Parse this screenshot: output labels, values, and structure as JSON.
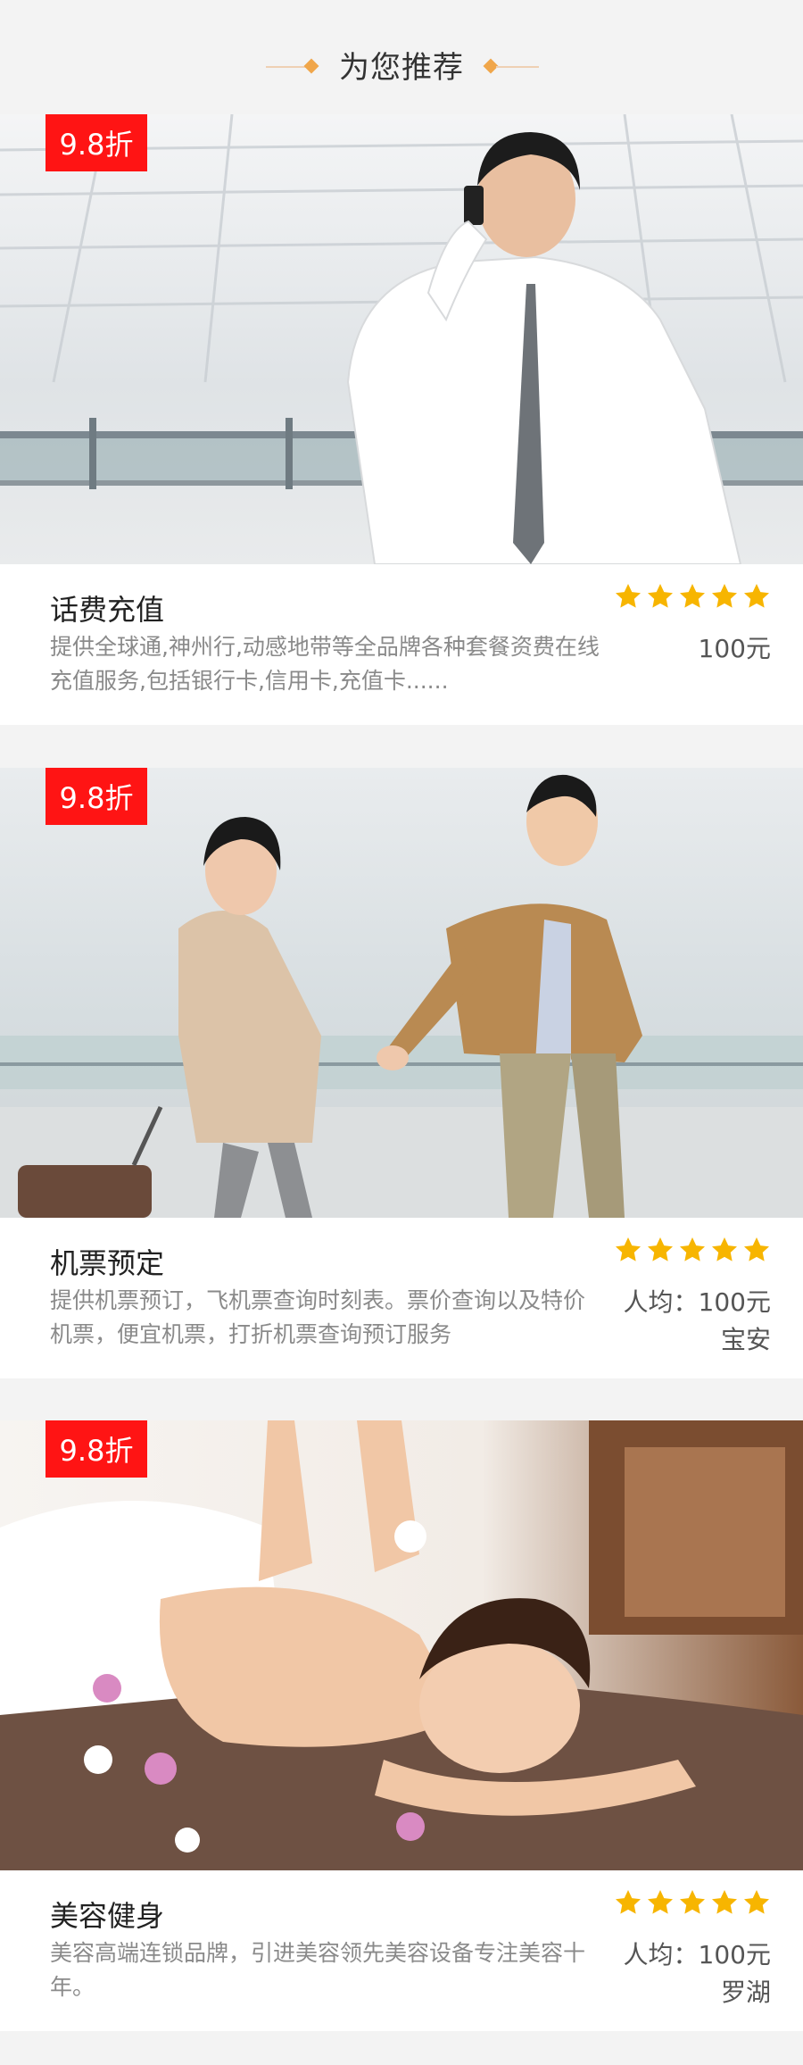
{
  "header": {
    "title": "为您推荐"
  },
  "accent_color": "#f0a64a",
  "badge_color": "#ff1414",
  "star_color": "#f7b500",
  "cards": [
    {
      "badge": "9.8折",
      "title": "话费充值",
      "description": "提供全球通,神州行,动感地带等全品牌各种套餐资费在线充值服务,包括银行卡,信用卡,充值卡......",
      "rating": 5,
      "price": "100元",
      "location": ""
    },
    {
      "badge": "9.8折",
      "title": "机票预定",
      "description": "提供机票预订，飞机票查询时刻表。票价查询以及特价机票，便宜机票，打折机票查询预订服务",
      "rating": 5,
      "price": "人均：100元",
      "location": "宝安"
    },
    {
      "badge": "9.8折",
      "title": "美容健身",
      "description": "美容高端连锁品牌，引进美容领先美容设备专注美容十年。",
      "rating": 5,
      "price": "人均：100元",
      "location": "罗湖"
    }
  ]
}
